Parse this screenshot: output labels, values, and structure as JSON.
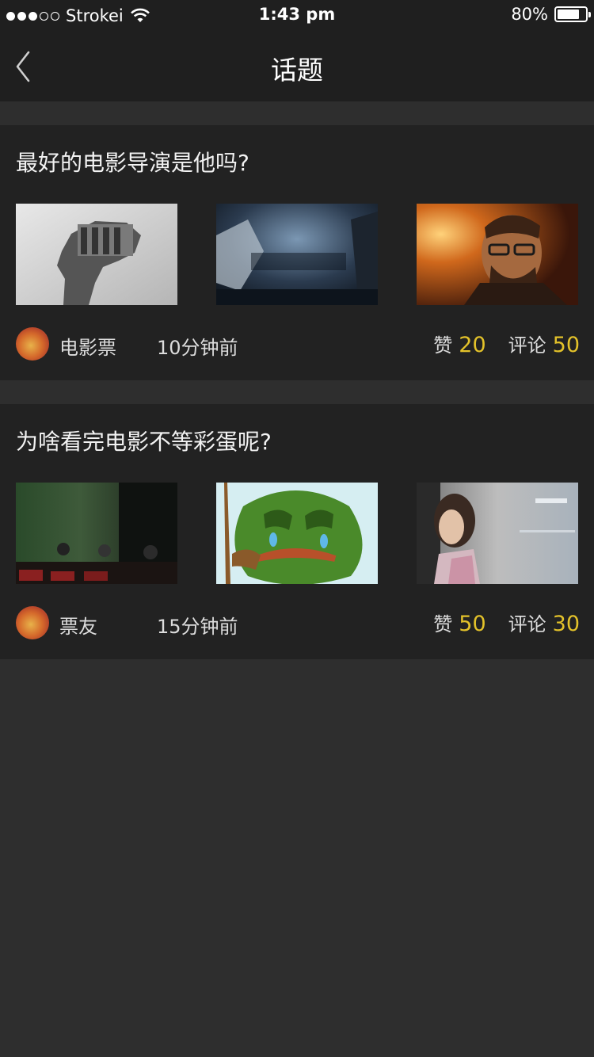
{
  "status_bar": {
    "carrier": "Strokei",
    "time": "1:43 pm",
    "battery": "80%",
    "battery_level": 0.8
  },
  "nav": {
    "title": "话题"
  },
  "colors": {
    "accent": "#e3c22a",
    "background": "#2e2e2e",
    "card": "#222222",
    "bar": "#1f1f1f"
  },
  "topics": [
    {
      "title": "最好的电影导演是他吗?",
      "author": "电影票",
      "time_ago": "10分钟前",
      "likes_label": "赞",
      "likes": "20",
      "comments_label": "评论",
      "comments": "50"
    },
    {
      "title": "为啥看完电影不等彩蛋呢?",
      "author": "票友",
      "time_ago": "15分钟前",
      "likes_label": "赞",
      "likes": "50",
      "comments_label": "评论",
      "comments": "30"
    }
  ]
}
